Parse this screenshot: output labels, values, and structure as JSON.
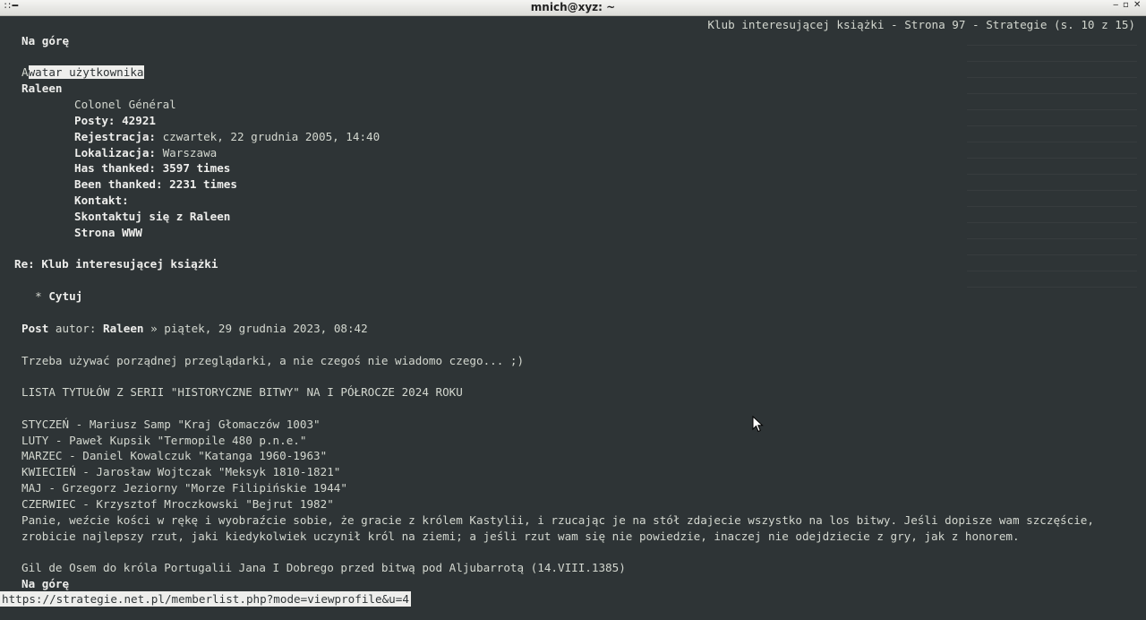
{
  "window": {
    "title": "mnich@xyz: ~",
    "menu_icon": "∷ ━",
    "buttons": [
      "‒",
      "▫",
      "✕"
    ]
  },
  "page_header": "Klub interesującej książki - Strona 97 - Strategie (s. 10 z 15)",
  "top_link": "Na górę",
  "avatar_alt": {
    "prefix": "A",
    "highlighted": "watar użytkownika"
  },
  "profile": {
    "username": "Raleen",
    "rank": "Colonel Général",
    "posts_label": "Posty:",
    "posts_value": "42921",
    "reg_label": "Rejestracja:",
    "reg_value": "czwartek, 22 grudnia 2005, 14:40",
    "loc_label": "Lokalizacja:",
    "loc_value": "Warszawa",
    "thanked": "Has thanked: 3597 times",
    "been_thanked": "Been thanked: 2231 times",
    "contact_label": "Kontakt:",
    "contact_link": "Skontaktuj się z Raleen",
    "www_link": "Strona WWW"
  },
  "post": {
    "subject": "Re: Klub interesującej książki",
    "quote_bullet": "  * ",
    "quote": "Cytuj",
    "author_label": "Post",
    "author_mid": " autor: ",
    "author": "Raleen",
    "date": " » piątek, 29 grudnia 2023, 08:42",
    "body1": "Trzeba używać porządnej przeglądarki, a nie czegoś nie wiadomo czego... ;)",
    "list_title": "LISTA TYTUŁÓW Z SERII \"HISTORYCZNE BITWY\" NA I PÓŁROCZE 2024 ROKU",
    "list": [
      "STYCZEŃ - Mariusz Samp \"Kraj Głomaczów 1003\"",
      "LUTY - Paweł Kupsik \"Termopile 480 p.n.e.\"",
      "MARZEC - Daniel Kowalczuk \"Katanga 1960-1963\"",
      "KWIECIEŃ - Jarosław Wojtczak \"Meksyk 1810-1821\"",
      "MAJ - Grzegorz Jeziorny \"Morze Filipińskie 1944\"",
      "CZERWIEC - Krzysztof Mroczkowski \"Bejrut 1982\""
    ],
    "sig1": "Panie, weźcie kości w rękę i wyobraźcie sobie, że gracie z królem Kastylii, i rzucając je na stół zdajecie wszystko na los bitwy. Jeśli dopisze wam szczęście,",
    "sig2": "zrobicie najlepszy rzut, jaki kiedykolwiek uczynił król na ziemi; a jeśli rzut wam się nie powiedzie, inaczej nie odejdziecie z gry, jak z honorem.",
    "sig3": "Gil de Osem do króla Portugalii Jana I Dobrego przed bitwą pod Aljubarrotą (14.VIII.1385)"
  },
  "status_url": "https://strategie.net.pl/memberlist.php?mode=viewprofile&u=4",
  "colors": {
    "bg": "#2e3436",
    "fg": "#d3d7cf",
    "bold": "#eeeeec"
  }
}
